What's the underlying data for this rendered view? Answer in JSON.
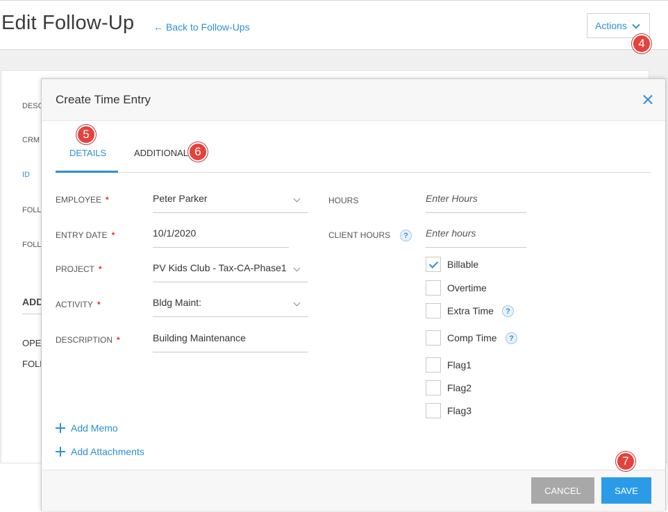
{
  "page": {
    "title": "Edit Follow-Up",
    "back_link": "Back to Follow-Ups",
    "actions_label": "Actions"
  },
  "background_card": {
    "labels": [
      "DESC",
      "CRM",
      "ID",
      "FOLL",
      "FOLL"
    ],
    "section_heading": "ADD",
    "bottom_lines": [
      "OPE",
      "FOLL"
    ]
  },
  "badges": [
    "4",
    "5",
    "6",
    "7"
  ],
  "modal": {
    "title": "Create Time Entry",
    "tabs": [
      {
        "label": "DETAILS",
        "active": true
      },
      {
        "label": "ADDITIONAL",
        "active": false
      }
    ],
    "fields": {
      "employee": {
        "label": "EMPLOYEE",
        "value": "Peter Parker"
      },
      "entry_date": {
        "label": "ENTRY DATE",
        "value": "10/1/2020"
      },
      "project": {
        "label": "PROJECT",
        "value": "PV Kids Club - Tax-CA-Phase1"
      },
      "activity": {
        "label": "ACTIVITY",
        "value": "Bldg Maint:"
      },
      "description": {
        "label": "DESCRIPTION",
        "value": "Building Maintenance"
      },
      "hours": {
        "label": "HOURS",
        "placeholder": "Enter Hours"
      },
      "client_hours": {
        "label": "CLIENT HOURS",
        "placeholder": "Enter hours"
      }
    },
    "required_mark": "*",
    "help_glyph": "?",
    "checkboxes": [
      {
        "label": "Billable",
        "checked": true
      },
      {
        "label": "Overtime",
        "checked": false
      },
      {
        "label": "Extra Time",
        "checked": false
      },
      {
        "label": "Comp Time",
        "checked": false
      },
      {
        "label": "Flag1",
        "checked": false
      },
      {
        "label": "Flag2",
        "checked": false
      },
      {
        "label": "Flag3",
        "checked": false
      }
    ],
    "add_memo": "Add Memo",
    "add_attachments": "Add Attachments",
    "cancel_label": "CANCEL",
    "save_label": "SAVE"
  },
  "colors": {
    "accent": "#2b8fd6",
    "badge": "#e4423d",
    "required": "#e02f2f",
    "cancel_button": "#a8a8a8",
    "save_button": "#2b9be8"
  }
}
